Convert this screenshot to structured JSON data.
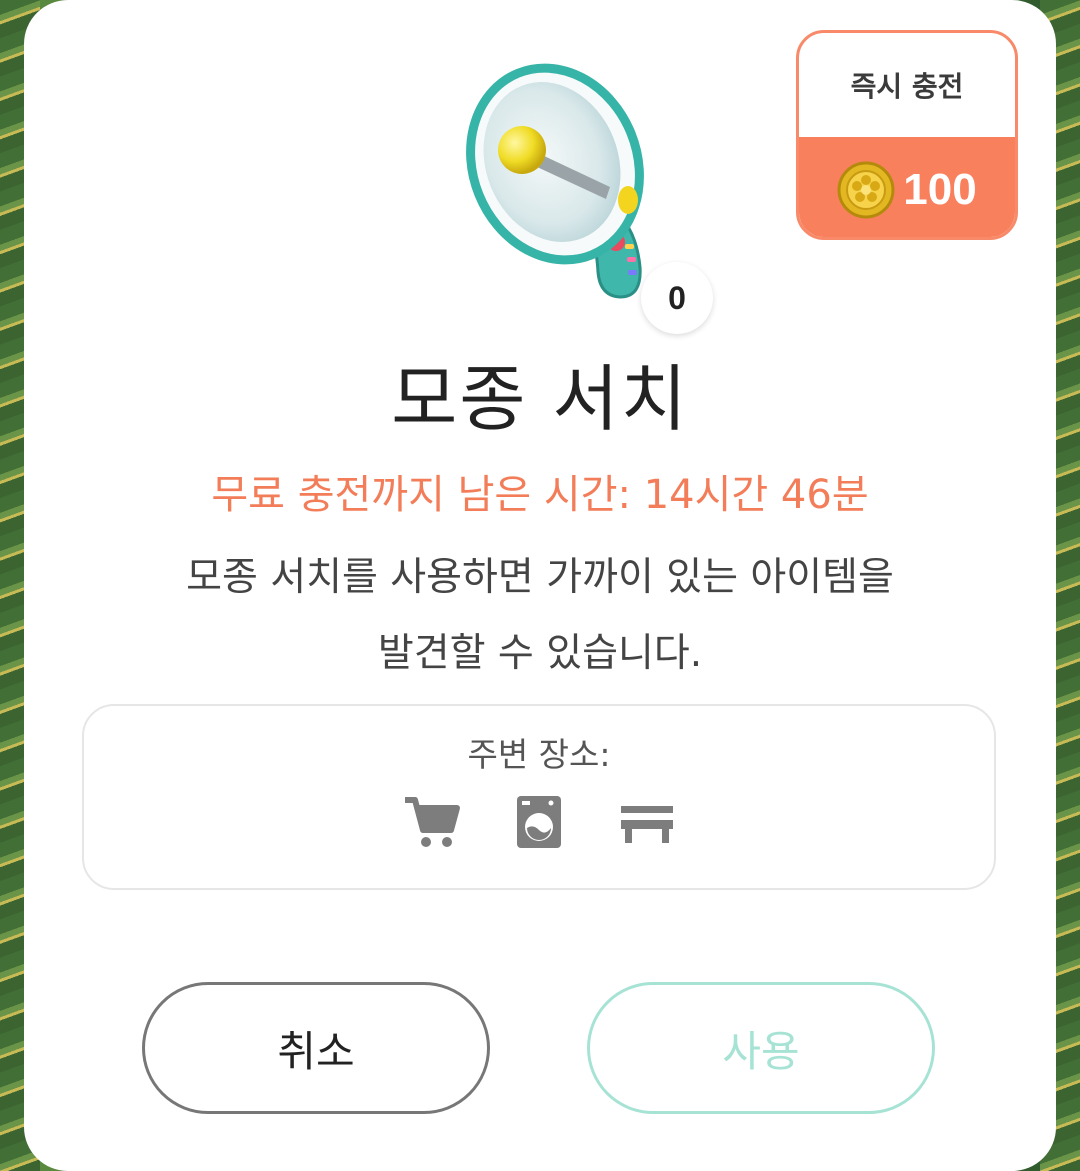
{
  "item": {
    "name": "모종 서치",
    "count": "0",
    "icon": "megaphone-icon"
  },
  "charge": {
    "title": "즉시 충전",
    "price": "100",
    "coin_icon": "coin-icon"
  },
  "timer_text": "무료 충전까지 남은 시간: 14시간 46분",
  "description": {
    "line1": "모종 서치를 사용하면 가까이 있는 아이템을",
    "line2": "발견할 수 있습니다."
  },
  "nearby": {
    "label": "주변 장소:",
    "places": [
      "cart-icon",
      "washing-machine-icon",
      "bench-icon"
    ]
  },
  "buttons": {
    "cancel": "취소",
    "use": "사용"
  },
  "colors": {
    "accent": "#f9805d",
    "timer": "#f27d58",
    "use_button": "#a6e3d4"
  }
}
